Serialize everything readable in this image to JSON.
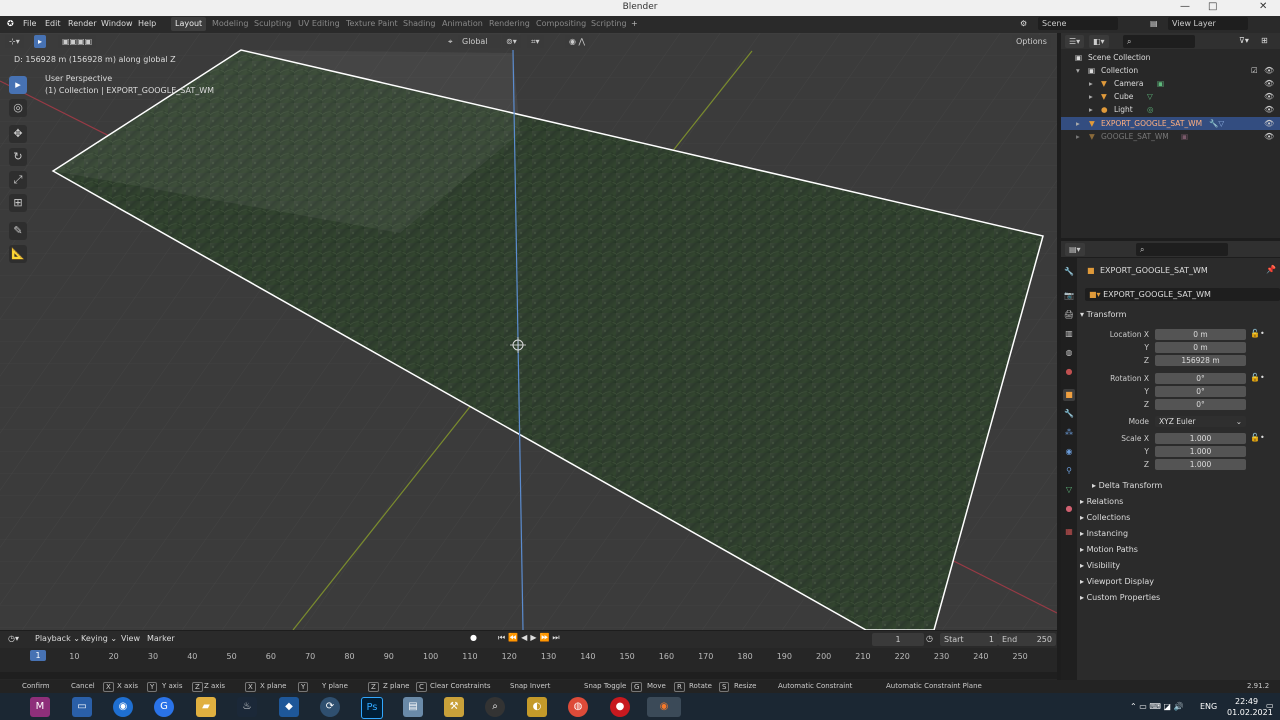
{
  "window": {
    "title": "Blender",
    "min": "—",
    "max": "□",
    "close": "✕"
  },
  "menu": [
    "File",
    "Edit",
    "Render",
    "Window",
    "Help"
  ],
  "workspaces": [
    "Layout",
    "Modeling",
    "Sculpting",
    "UV Editing",
    "Texture Paint",
    "Shading",
    "Animation",
    "Rendering",
    "Compositing",
    "Scripting",
    "+"
  ],
  "scene": {
    "name": "Scene",
    "view_layer": "View Layer"
  },
  "viewport": {
    "transform_orientation": "Global",
    "options": "Options",
    "info": "D: 156928 m (156928 m) along global Z",
    "perspective": "User Perspective",
    "collection_info": "(1) Collection | EXPORT_GOOGLE_SAT_WM"
  },
  "outliner": {
    "scene_collection": "Scene Collection",
    "items": [
      {
        "label": "Collection",
        "indent": 0
      },
      {
        "label": "Camera",
        "indent": 1
      },
      {
        "label": "Cube",
        "indent": 1
      },
      {
        "label": "Light",
        "indent": 1
      },
      {
        "label": "EXPORT_GOOGLE_SAT_WM",
        "indent": 1,
        "selected": true
      },
      {
        "label": "GOOGLE_SAT_WM",
        "indent": 1,
        "dim": true
      }
    ]
  },
  "properties": {
    "object_name": "EXPORT_GOOGLE_SAT_WM",
    "object_field": "EXPORT_GOOGLE_SAT_WM",
    "transform_label": "Transform",
    "location_x_label": "Location X",
    "location_x": "0 m",
    "location_y_label": "Y",
    "location_y": "0 m",
    "location_z_label": "Z",
    "location_z": "156928 m",
    "rotation_x_label": "Rotation X",
    "rotation_x": "0°",
    "rotation_y_label": "Y",
    "rotation_y": "0°",
    "rotation_z_label": "Z",
    "rotation_z": "0°",
    "mode_label": "Mode",
    "mode": "XYZ Euler",
    "scale_x_label": "Scale X",
    "scale_x": "1.000",
    "scale_y_label": "Y",
    "scale_y": "1.000",
    "scale_z_label": "Z",
    "scale_z": "1.000",
    "delta_transform": "Delta Transform",
    "panels": [
      "Relations",
      "Collections",
      "Instancing",
      "Motion Paths",
      "Visibility",
      "Viewport Display",
      "Custom Properties"
    ]
  },
  "timeline": {
    "menus": [
      "Playback",
      "Keying",
      "View",
      "Marker"
    ],
    "current_frame": "1",
    "start_label": "Start",
    "start": "1",
    "end_label": "End",
    "end": "250",
    "ticks": [
      "1",
      "10",
      "20",
      "30",
      "40",
      "50",
      "60",
      "70",
      "80",
      "90",
      "100",
      "110",
      "120",
      "130",
      "140",
      "150",
      "160",
      "170",
      "180",
      "190",
      "200",
      "210",
      "220",
      "230",
      "240",
      "250"
    ]
  },
  "statusbar": {
    "items": [
      "Confirm",
      "Cancel",
      "X axis",
      "Y axis",
      "Z axis",
      "X plane",
      "Y plane",
      "Z plane",
      "Clear Constraints",
      "Snap Invert",
      "Snap Toggle",
      "Move",
      "Rotate",
      "Resize",
      "Automatic Constraint",
      "Automatic Constraint Plane"
    ],
    "keys": [
      "X",
      "Y",
      "Z",
      "X",
      "Y",
      "Z",
      "C",
      "G",
      "R",
      "S"
    ],
    "version": "2.91.2"
  },
  "taskbar": {
    "lang": "ENG",
    "time": "22:49",
    "date": "01.02.2021"
  },
  "colors": {
    "accent": "#4772b3",
    "selected_row": "#334d80",
    "axis_x": "#b03a48",
    "axis_y": "#8aa02a",
    "axis_z": "#5b8ccf"
  }
}
